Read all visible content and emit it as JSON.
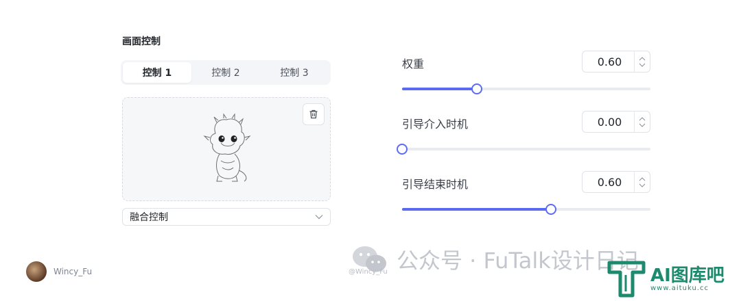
{
  "section_title": "画面控制",
  "tabs": [
    {
      "label": "控制 1",
      "active": true
    },
    {
      "label": "控制 2",
      "active": false
    },
    {
      "label": "控制 3",
      "active": false
    }
  ],
  "upload": {
    "delete_icon": "trash-icon",
    "preview": "dragon-line-sketch"
  },
  "select": {
    "value": "融合控制",
    "icon": "chevron-down-icon"
  },
  "params": [
    {
      "label": "权重",
      "value": "0.60",
      "slider": 0.3
    },
    {
      "label": "引导介入时机",
      "value": "0.00",
      "slider": 0.0
    },
    {
      "label": "引导结束时机",
      "value": "0.60",
      "slider": 0.6
    }
  ],
  "author": {
    "name": "Wincy_Fu"
  },
  "watermark": {
    "handle": "@Wincy_Fu",
    "text": "公众号 · FuTalk设计日记",
    "site_title": "AI图库吧",
    "site_url": "www.aituku.cc"
  },
  "colors": {
    "accent": "#5b6af3",
    "track": "#e8ebef",
    "watermark_green": "#1e8a6d"
  }
}
